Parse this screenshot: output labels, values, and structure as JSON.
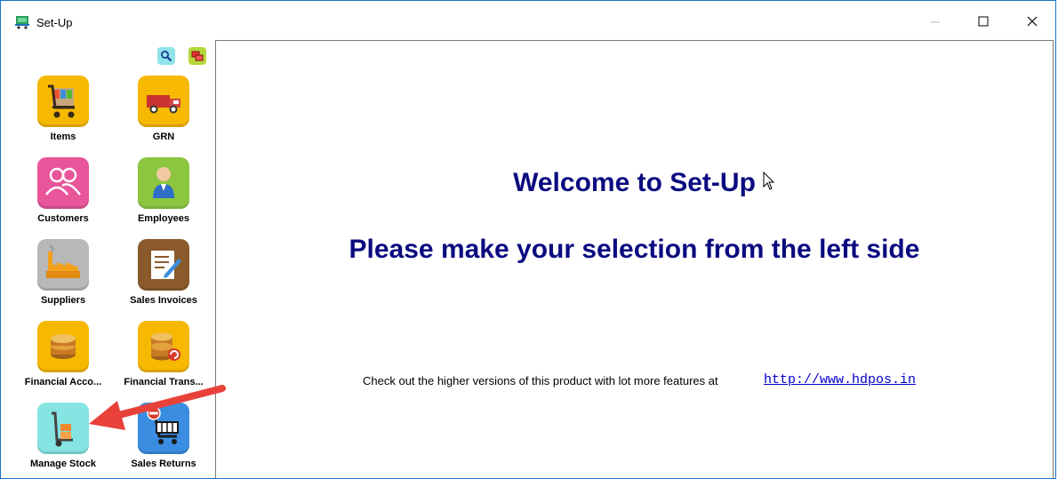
{
  "window": {
    "title": "Set-Up",
    "controls": {
      "minimize": "minimize-icon",
      "maximize": "maximize-icon",
      "close": "close-icon"
    }
  },
  "sidebar": {
    "tools": [
      {
        "icon": "search-icon"
      },
      {
        "icon": "windows-icon"
      }
    ],
    "items": [
      {
        "label": "Items",
        "icon": "shopping-cart-icon",
        "color": "#f6b800"
      },
      {
        "label": "GRN",
        "icon": "delivery-truck-icon",
        "color": "#f6b800"
      },
      {
        "label": "Customers",
        "icon": "customers-icon",
        "color": "#e8559b"
      },
      {
        "label": "Employees",
        "icon": "employee-icon",
        "color": "#8cc63f"
      },
      {
        "label": "Suppliers",
        "icon": "factory-icon",
        "color": "#a9a9a9"
      },
      {
        "label": "Sales Invoices",
        "icon": "invoice-icon",
        "color": "#8a5a2b"
      },
      {
        "label": "Financial Acco...",
        "icon": "coins-icon",
        "color": "#f6b800"
      },
      {
        "label": "Financial Trans...",
        "icon": "coins-refresh-icon",
        "color": "#f6b800"
      },
      {
        "label": "Manage Stock",
        "icon": "hand-truck-icon",
        "color": "#7fe0df"
      },
      {
        "label": "Sales Returns",
        "icon": "cart-return-icon",
        "color": "#3a8de0"
      }
    ]
  },
  "main": {
    "welcome": "Welcome to Set-Up",
    "instruction": "Please make your selection from the left side",
    "info_text": "Check out the higher versions of this product with lot more features at",
    "link_text": "http://www.hdpos.in"
  },
  "annotation": {
    "icon": "red-arrow-icon",
    "color": "#e8413a"
  }
}
